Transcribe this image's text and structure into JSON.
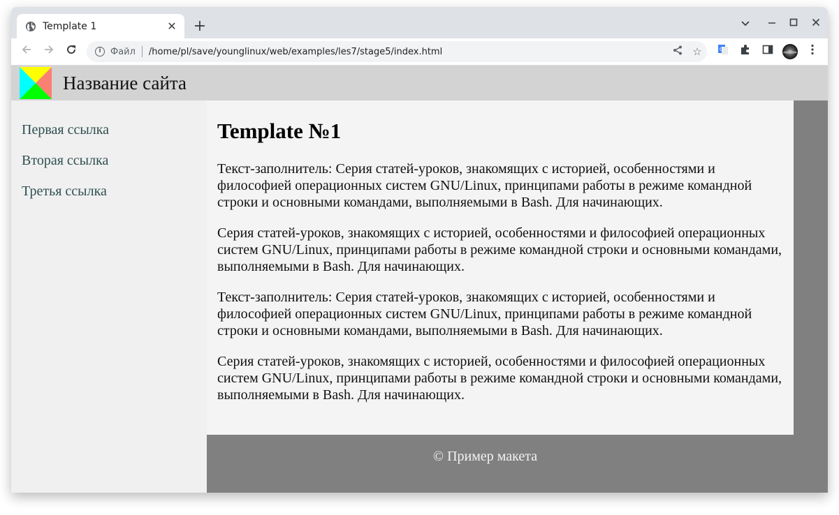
{
  "browser": {
    "tab": {
      "title": "Template 1",
      "icon": "globe-icon"
    },
    "new_tab_label": "+",
    "window_controls": {
      "tab_search": "⌄",
      "minimize": "–",
      "maximize": "☐",
      "close": "✕"
    },
    "omnibox": {
      "scheme_label": "Файл",
      "url": "/home/pl/save/younglinux/web/examples/les7/stage5/index.html"
    }
  },
  "page": {
    "header": {
      "site_name": "Название сайта",
      "logo_colors": {
        "top": "#ffff00",
        "right": "#fa8072",
        "bottom": "#00ff00",
        "left": "#00ffff"
      }
    },
    "sidebar": {
      "links": [
        {
          "label": "Первая ссылка"
        },
        {
          "label": "Вторая ссылка"
        },
        {
          "label": "Третья ссылка"
        }
      ]
    },
    "main": {
      "title": "Template №1",
      "paragraphs": [
        "Текст-заполнитель: Серия статей-уроков, знакомящих с историей, особенностями и философией операционных систем GNU/Linux, принципами работы в режиме командной строки и основными командами, выполняемыми в Bash. Для начинающих.",
        "Серия статей-уроков, знакомящих с историей, особенностями и философией операционных систем GNU/Linux, принципами работы в режиме командной строки и основными командами, выполняемыми в Bash. Для начинающих.",
        "Текст-заполнитель: Серия статей-уроков, знакомящих с историей, особенностями и философией операционных систем GNU/Linux, принципами работы в режиме командной строки и основными командами, выполняемыми в Bash. Для начинающих.",
        "Серия статей-уроков, знакомящих с историей, особенностями и философией операционных систем GNU/Linux, принципами работы в режиме командной строки и основными командами, выполняемыми в Bash. Для начинающих."
      ]
    },
    "footer": {
      "text": "© Пример макета"
    },
    "colors": {
      "header_bg": "#d3d3d3",
      "sidebar_bg": "#f0f0f0",
      "main_bg": "#f4f4f4",
      "page_bg": "#808080",
      "link_color": "#2f4f4f"
    }
  }
}
